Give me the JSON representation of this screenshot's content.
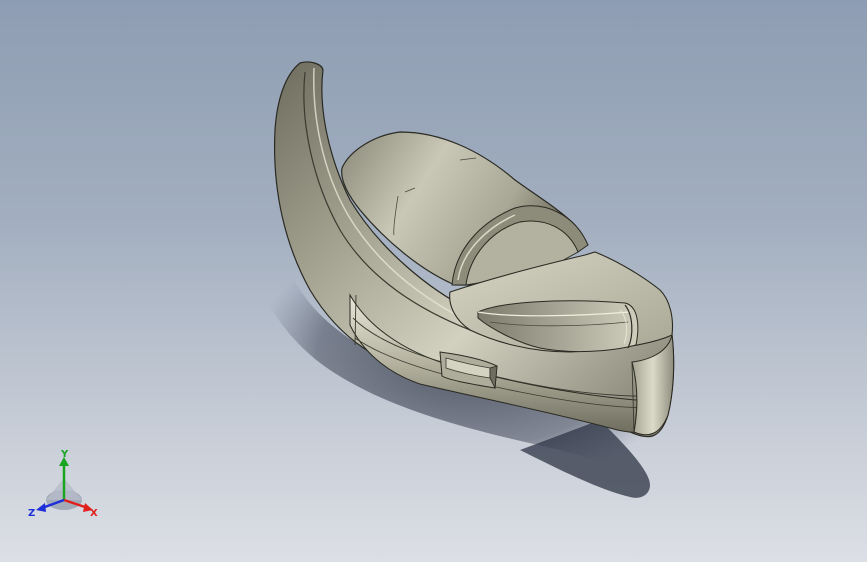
{
  "viewport": {
    "background_top": "#8e9db3",
    "background_bottom": "#dcdfe5"
  },
  "model": {
    "body_color": "#b9b7a4",
    "shadow_color": "#3a4050",
    "edge_color": "#2a2a22"
  },
  "triad": {
    "x_label": "X",
    "y_label": "Y",
    "z_label": "Z",
    "x_color": "#e0201c",
    "y_color": "#1aa520",
    "z_color": "#1e2fd8"
  }
}
